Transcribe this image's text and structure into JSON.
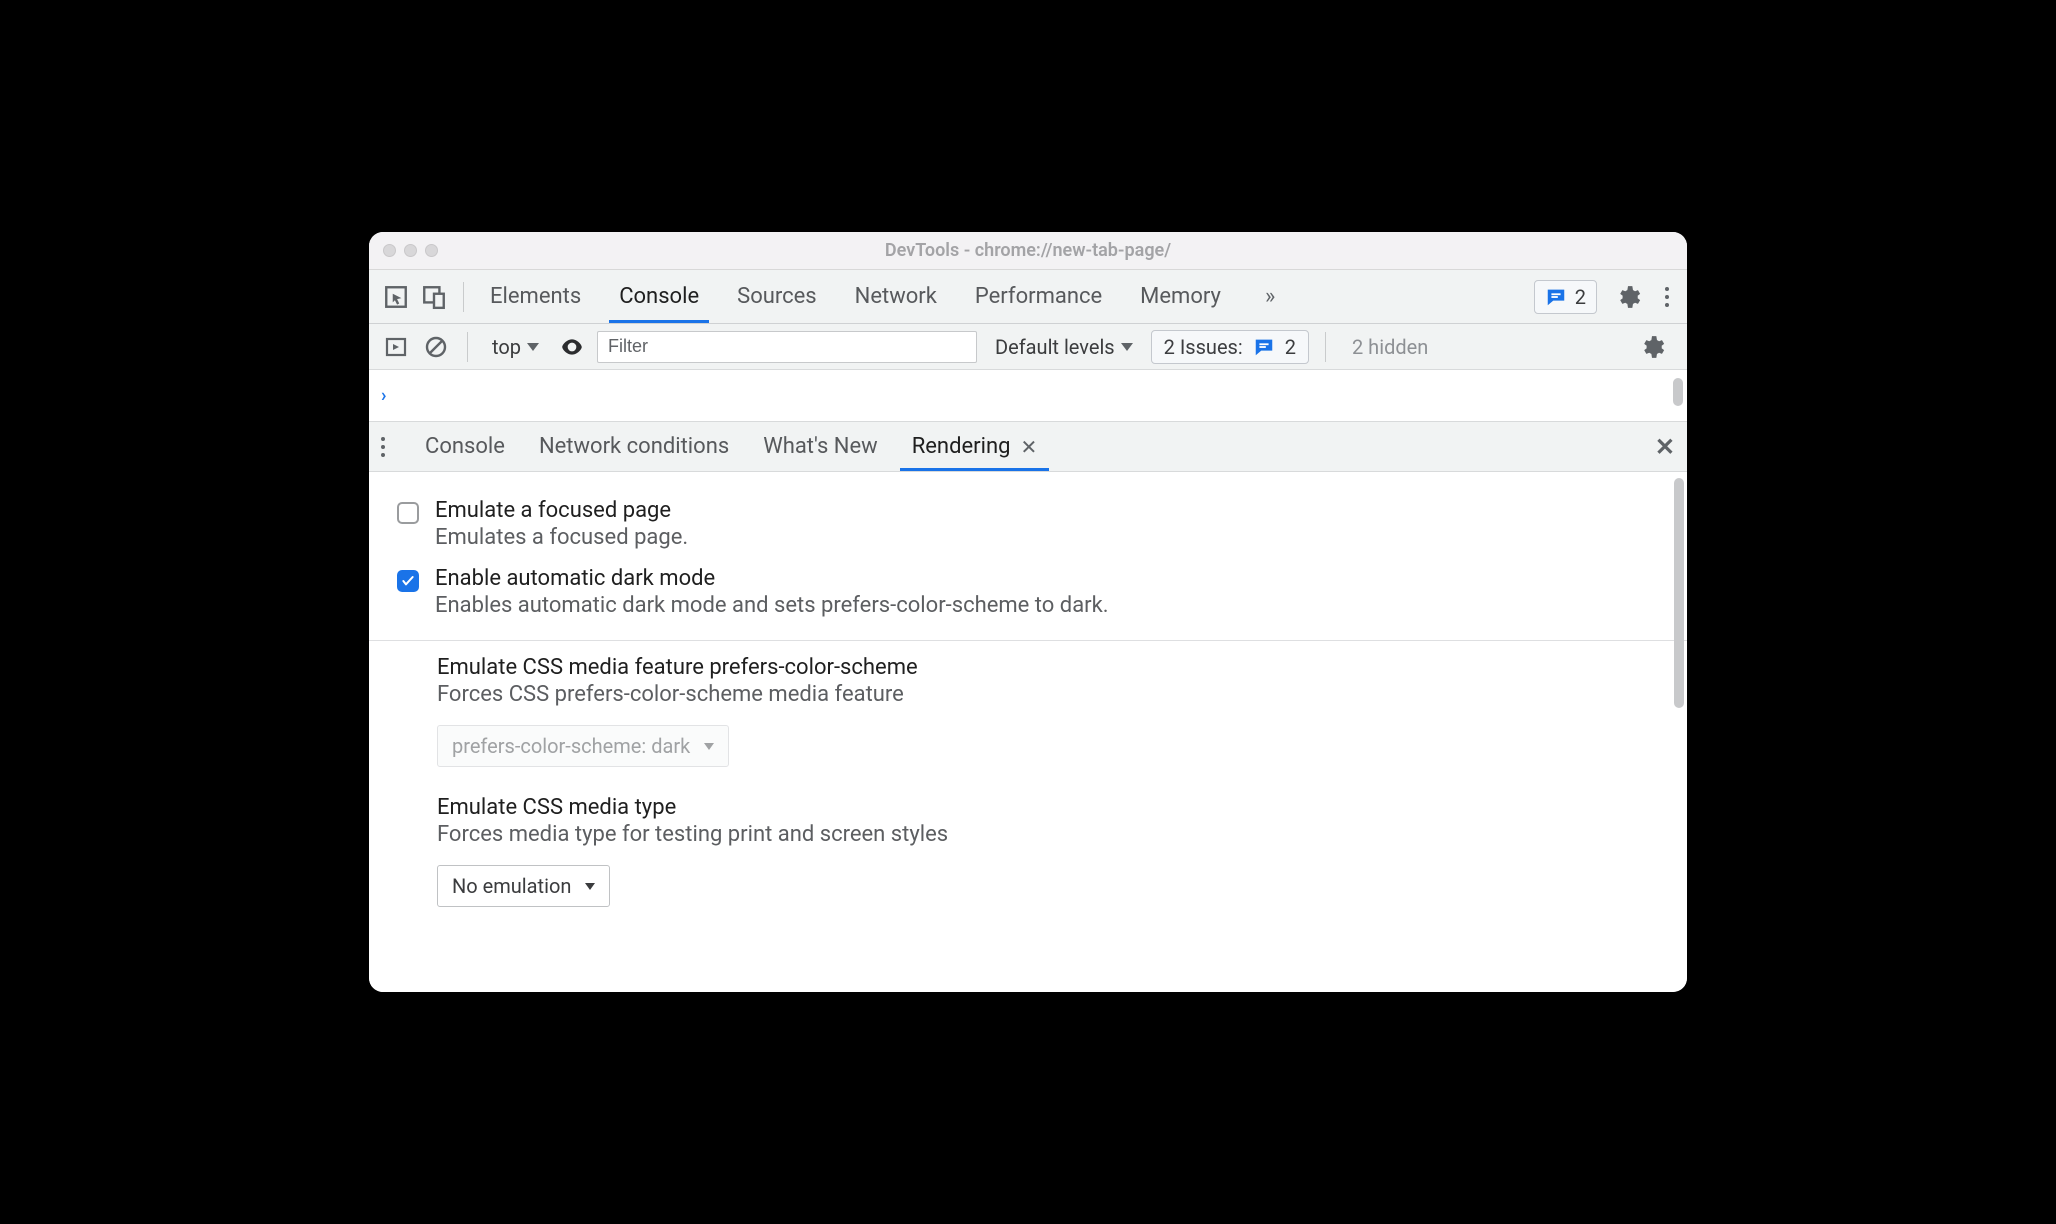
{
  "window": {
    "title": "DevTools - chrome://new-tab-page/"
  },
  "main_tabs": {
    "items": [
      "Elements",
      "Console",
      "Sources",
      "Network",
      "Performance",
      "Memory"
    ],
    "active_index": 1,
    "overflow_glyph": "»"
  },
  "toolbar_right": {
    "message_count": "2"
  },
  "console_toolbar": {
    "context_label": "top",
    "filter_placeholder": "Filter",
    "levels_label": "Default levels",
    "issues_label": "2 Issues:",
    "issues_count": "2",
    "hidden_label": "2 hidden"
  },
  "console_prompt": {
    "glyph": "›"
  },
  "drawer": {
    "tabs": [
      {
        "label": "Console",
        "closeable": false
      },
      {
        "label": "Network conditions",
        "closeable": false
      },
      {
        "label": "What's New",
        "closeable": false
      },
      {
        "label": "Rendering",
        "closeable": true
      }
    ],
    "active_index": 3
  },
  "rendering": {
    "opt1": {
      "title": "Emulate a focused page",
      "desc": "Emulates a focused page.",
      "checked": false
    },
    "opt2": {
      "title": "Enable automatic dark mode",
      "desc": "Enables automatic dark mode and sets prefers-color-scheme to dark.",
      "checked": true
    },
    "pcs": {
      "title": "Emulate CSS media feature prefers-color-scheme",
      "desc": "Forces CSS prefers-color-scheme media feature",
      "value": "prefers-color-scheme: dark"
    },
    "media": {
      "title": "Emulate CSS media type",
      "desc": "Forces media type for testing print and screen styles",
      "value": "No emulation"
    }
  }
}
